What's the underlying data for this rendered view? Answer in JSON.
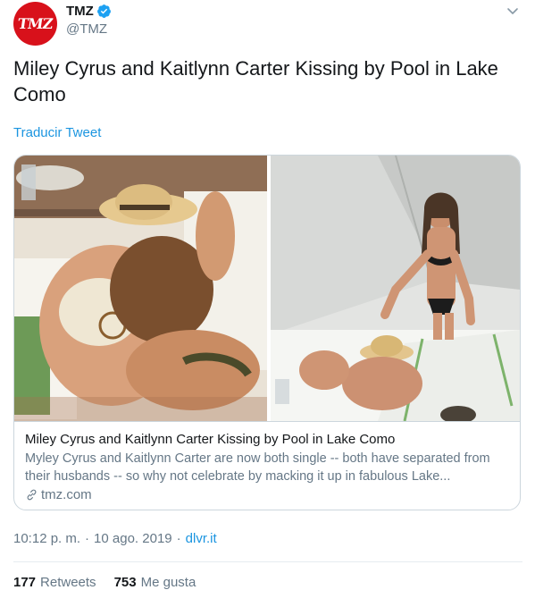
{
  "account": {
    "display_name": "TMZ",
    "handle": "@TMZ",
    "avatar_text": "TMZ",
    "verified": true
  },
  "tweet": {
    "text": "Miley Cyrus and Kaitlynn Carter Kissing by Pool in Lake Como",
    "translate_label": "Traducir Tweet"
  },
  "card": {
    "title": "Miley Cyrus and Kaitlynn Carter Kissing by Pool in Lake Como",
    "description": "Myley Cyrus and Kaitlynn Carter are now both single -- both have separated from their husbands -- so why not celebrate by macking it up in fabulous Lake...",
    "domain": "tmz.com",
    "images": [
      {
        "icon": "photo-left",
        "subject": "poolside-photo"
      },
      {
        "icon": "photo-right",
        "subject": "poolside-photo"
      }
    ]
  },
  "meta": {
    "time": "10:12 p. m.",
    "date": "10 ago. 2019",
    "separator": "·",
    "source": "dlvr.it"
  },
  "stats": {
    "retweets_count": "177",
    "retweets_label": "Retweets",
    "likes_count": "753",
    "likes_label": "Me gusta"
  },
  "colors": {
    "link": "#1b95e0",
    "secondary_text": "#657786",
    "avatar_bg": "#d8111b",
    "border": "#ccd6dd"
  }
}
